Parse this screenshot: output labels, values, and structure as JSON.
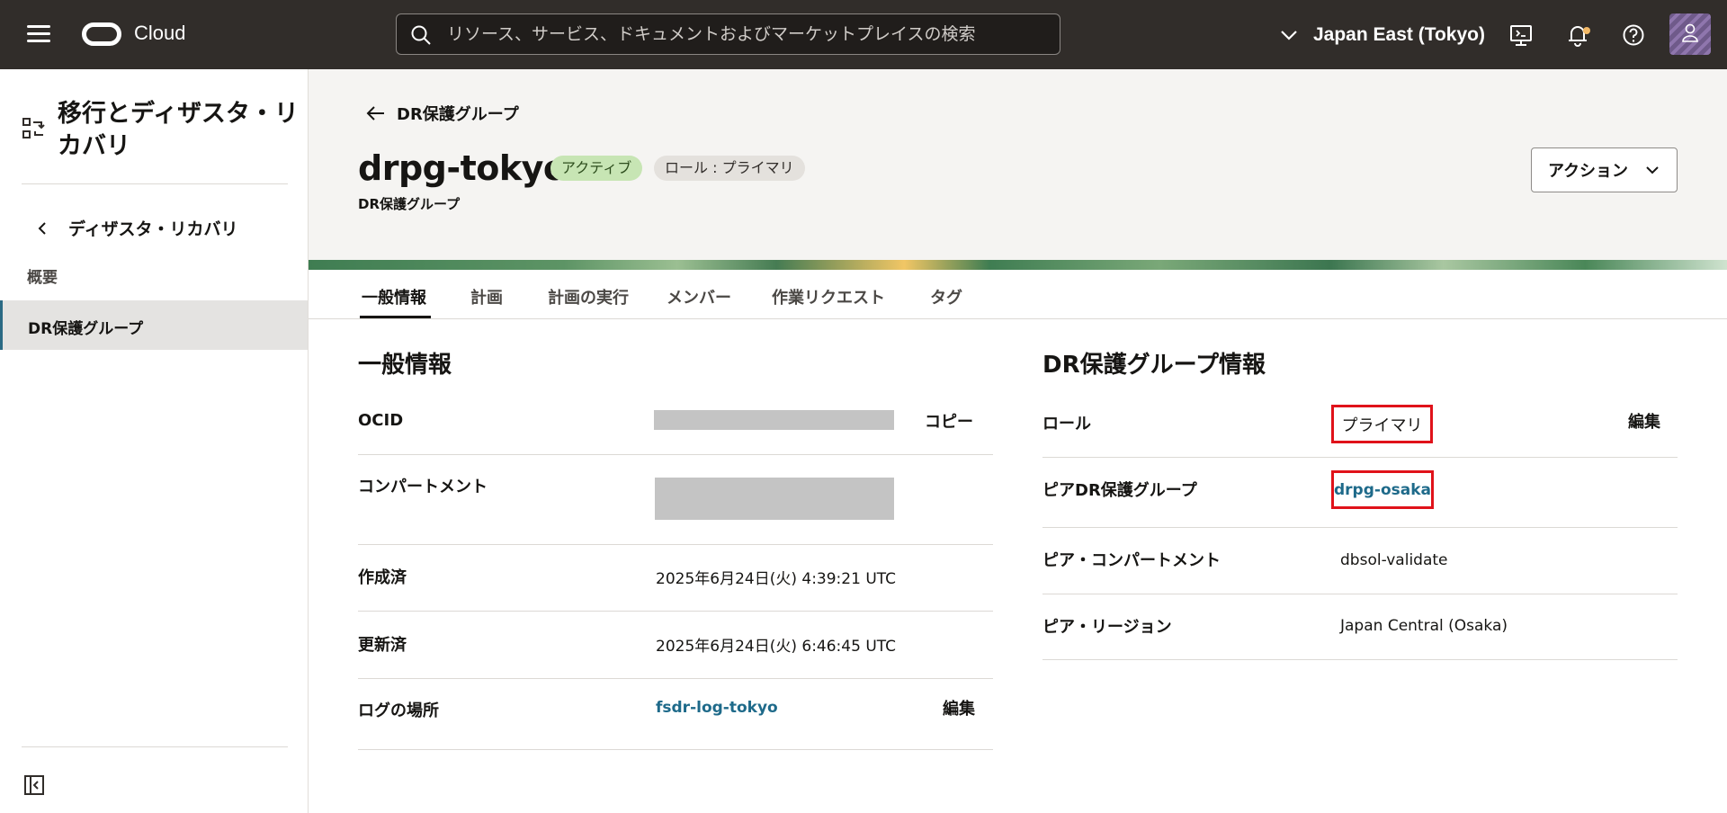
{
  "header": {
    "brand": "Cloud",
    "search_placeholder": "リソース、サービス、ドキュメントおよびマーケットプレイスの検索",
    "region": "Japan East (Tokyo)"
  },
  "sidebar": {
    "title": "移行とディザスタ・リカバリ",
    "back_label": "ディザスタ・リカバリ",
    "overview": "概要",
    "active_item": "DR保護グループ"
  },
  "page": {
    "breadcrumb": "DR保護グループ",
    "title": "drpg-tokyo",
    "status_badge": "アクティブ",
    "role_badge": "ロール : プライマリ",
    "subtitle": "DR保護グループ",
    "action_button": "アクション"
  },
  "tabs": [
    "一般情報",
    "計画",
    "計画の実行",
    "メンバー",
    "作業リクエスト",
    "タグ"
  ],
  "general": {
    "title": "一般情報",
    "ocid_label": "OCID",
    "copy_action": "コピー",
    "compartment_label": "コンパートメント",
    "created_label": "作成済",
    "created_value": "2025年6月24日(火) 4:39:21 UTC",
    "updated_label": "更新済",
    "updated_value": "2025年6月24日(火) 6:46:45 UTC",
    "log_label": "ログの場所",
    "log_value": "fsdr-log-tokyo",
    "edit_action": "編集"
  },
  "drinfo": {
    "title": "DR保護グループ情報",
    "role_label": "ロール",
    "role_value": "プライマリ",
    "edit_action": "編集",
    "peer_label": "ピアDR保護グループ",
    "peer_value": "drpg-osaka",
    "peer_comp_label": "ピア・コンパートメント",
    "peer_comp_value": "dbsol-validate",
    "peer_region_label": "ピア・リージョン",
    "peer_region_value": "Japan Central (Osaka)"
  },
  "colors": {
    "header_bg": "#312d2a",
    "link": "#1e6a8a",
    "highlight": "#e0121a",
    "active_badge": "#c7e5b4"
  }
}
